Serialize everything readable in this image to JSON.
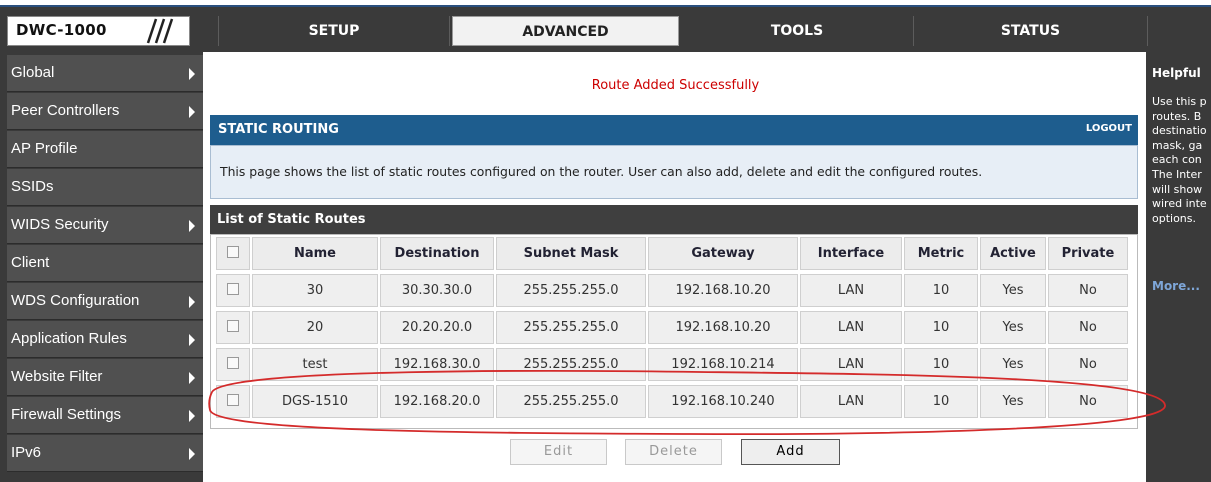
{
  "header": {
    "logo": "DWC-1000",
    "tabs": [
      {
        "label": "SETUP"
      },
      {
        "label": "ADVANCED"
      },
      {
        "label": "TOOLS"
      },
      {
        "label": "STATUS"
      }
    ]
  },
  "sidebar": {
    "items": [
      {
        "label": "Global",
        "arrow": true
      },
      {
        "label": "Peer Controllers",
        "arrow": true
      },
      {
        "label": "AP Profile",
        "arrow": false
      },
      {
        "label": "SSIDs",
        "arrow": false
      },
      {
        "label": "WIDS Security",
        "arrow": true
      },
      {
        "label": "Client",
        "arrow": false
      },
      {
        "label": "WDS Configuration",
        "arrow": true
      },
      {
        "label": "Application Rules",
        "arrow": true
      },
      {
        "label": "Website Filter",
        "arrow": true
      },
      {
        "label": "Firewall Settings",
        "arrow": true
      },
      {
        "label": "IPv6",
        "arrow": true
      }
    ]
  },
  "main": {
    "success_message": "Route Added Successfully",
    "section_title": "STATIC ROUTING",
    "logout": "LOGOUT",
    "description": "This page shows the list of static routes configured on the router. User can also add, delete and edit the configured routes.",
    "list_title": "List of Static Routes",
    "table": {
      "headers": [
        "Name",
        "Destination",
        "Subnet Mask",
        "Gateway",
        "Interface",
        "Metric",
        "Active",
        "Private"
      ],
      "rows": [
        [
          "30",
          "30.30.30.0",
          "255.255.255.0",
          "192.168.10.20",
          "LAN",
          "10",
          "Yes",
          "No"
        ],
        [
          "20",
          "20.20.20.0",
          "255.255.255.0",
          "192.168.10.20",
          "LAN",
          "10",
          "Yes",
          "No"
        ],
        [
          "test",
          "192.168.30.0",
          "255.255.255.0",
          "192.168.10.214",
          "LAN",
          "10",
          "Yes",
          "No"
        ],
        [
          "DGS-1510",
          "192.168.20.0",
          "255.255.255.0",
          "192.168.10.240",
          "LAN",
          "10",
          "Yes",
          "No"
        ]
      ]
    },
    "buttons": {
      "edit": "Edit",
      "delete": "Delete",
      "add": "Add"
    }
  },
  "help": {
    "title": "Helpful",
    "lines": [
      "Use this p",
      "routes. B",
      "destinatio",
      "mask, ga",
      "each con",
      "The Inter",
      "will show",
      "wired inte",
      "options."
    ],
    "more": "More..."
  },
  "colors": {
    "header_bg": "#3a3a3a",
    "sidebar_item_bg": "#505050",
    "section_bar": "#1e5d8e",
    "success_text": "#cc0000",
    "annotation_ellipse": "#d42b2b"
  }
}
